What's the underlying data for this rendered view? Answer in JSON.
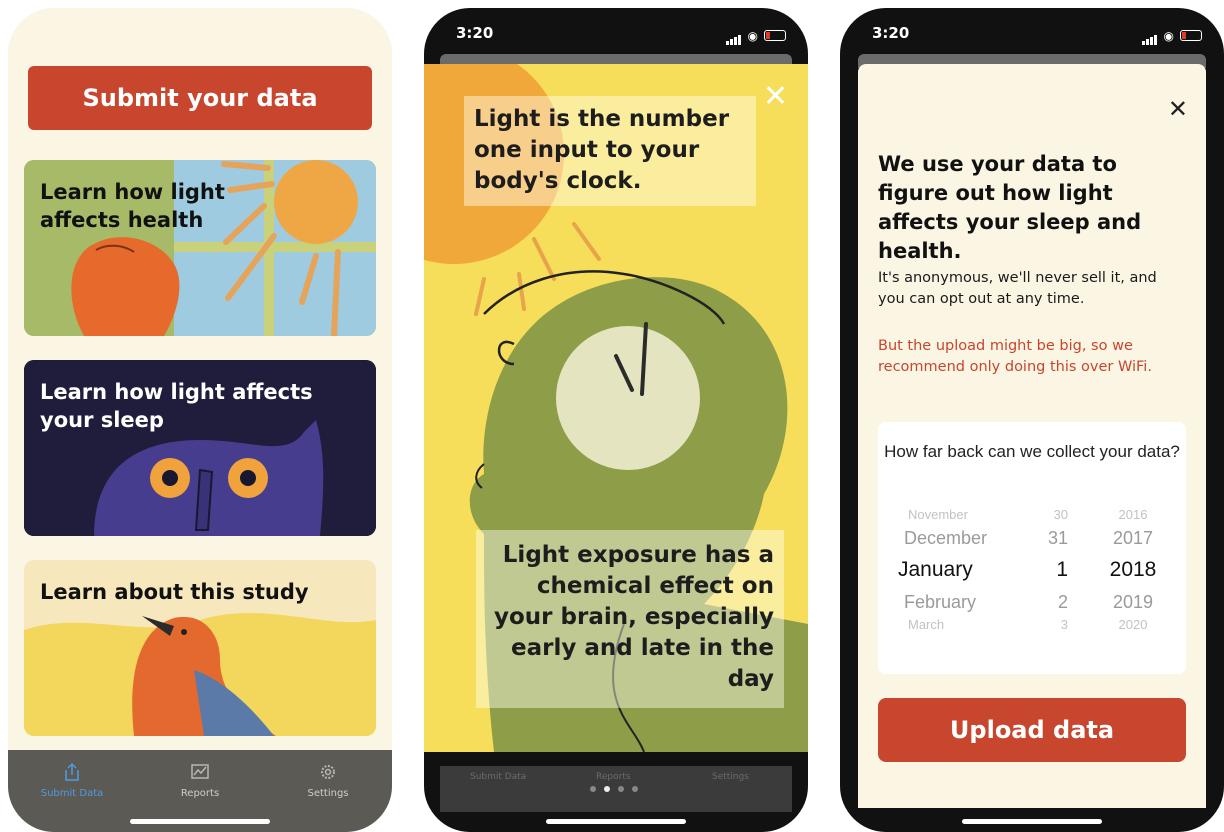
{
  "phone1": {
    "submit_label": "Submit your data",
    "cards": [
      {
        "title": "Learn how light affects health"
      },
      {
        "title": "Learn how light affects your sleep"
      },
      {
        "title": "Learn about this study"
      }
    ],
    "tabs": [
      {
        "label": "Submit Data",
        "icon": "share-icon"
      },
      {
        "label": "Reports",
        "icon": "reports-icon"
      },
      {
        "label": "Settings",
        "icon": "gear-icon"
      }
    ],
    "accent": "#c8452e"
  },
  "phone2": {
    "status_time": "3:20",
    "text_top": "Light is the number one input to your body's clock.",
    "text_bottom": "Light exposure has a chemical effect on your brain, especially early and late in the day",
    "close_icon": "close-icon",
    "behind_tabs": [
      "Submit Data",
      "Reports",
      "Settings"
    ]
  },
  "phone3": {
    "status_time": "3:20",
    "heading": "We use your data to figure out how light affects your sleep and health.",
    "para1": "It's anonymous, we'll never sell it, and you can opt out at any time.",
    "para2": "But the upload might be big, so we recommend only doing this over WiFi.",
    "picker_question": "How far back can we collect your data?",
    "picker": {
      "months": [
        "November",
        "December",
        "January",
        "February",
        "March"
      ],
      "days": [
        "30",
        "31",
        "1",
        "2",
        "3"
      ],
      "years": [
        "2016",
        "2017",
        "2018",
        "2019",
        "2020"
      ],
      "selected": {
        "month": "January",
        "day": "1",
        "year": "2018"
      }
    },
    "upload_label": "Upload data",
    "warning_color": "#c8452e"
  }
}
